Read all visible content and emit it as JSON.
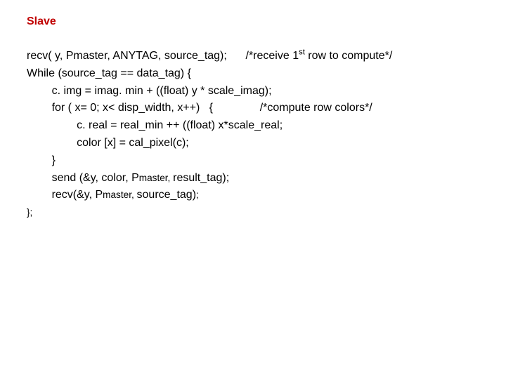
{
  "heading": "Slave",
  "code": {
    "l1a": "recv( y, Pmaster, ANYTAG, source_tag);      /*receive 1",
    "l1_sup": "st",
    "l1b": " row to compute*/",
    "l2": "While (source_tag == data_tag) {",
    "l3": "        c. img = imag. min + ((float) y * scale_imag);",
    "l4": "        for ( x= 0; x< disp_width, x++)   {               /*compute row colors*/",
    "l5": "                c. real = real_min ++ ((float) x*scale_real;",
    "l6": "                color [x] = cal_pixel(c);",
    "l7": "        }",
    "l8a": "        send (&y, color, P",
    "l8_small": "master, ",
    "l8b": "result_tag);",
    "l9a": "        recv(&y, P",
    "l9_small": "master, ",
    "l9b": "source_tag)",
    "l9_small2": ";",
    "l10": "};"
  }
}
